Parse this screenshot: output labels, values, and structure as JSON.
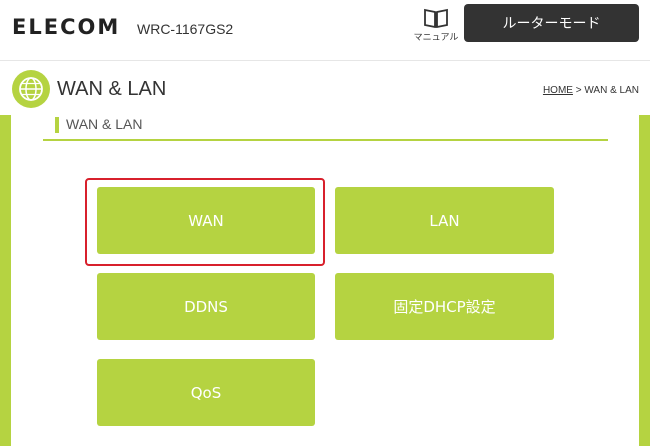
{
  "header": {
    "brand": "ELECOM",
    "model": "WRC-1167GS2",
    "manual_label": "マニュアル",
    "mode_label": "ルーターモード"
  },
  "title_bar": {
    "title": "WAN & LAN",
    "breadcrumb_home": "HOME",
    "breadcrumb_sep": " > ",
    "breadcrumb_current": "WAN & LAN"
  },
  "section": {
    "title": "WAN & LAN"
  },
  "menu": {
    "wan": "WAN",
    "lan": "LAN",
    "ddns": "DDNS",
    "dhcp": "固定DHCP設定",
    "qos": "QoS"
  },
  "colors": {
    "accent_green": "#b5d341",
    "dark_button": "#333333",
    "highlight_red": "#d8202c"
  }
}
